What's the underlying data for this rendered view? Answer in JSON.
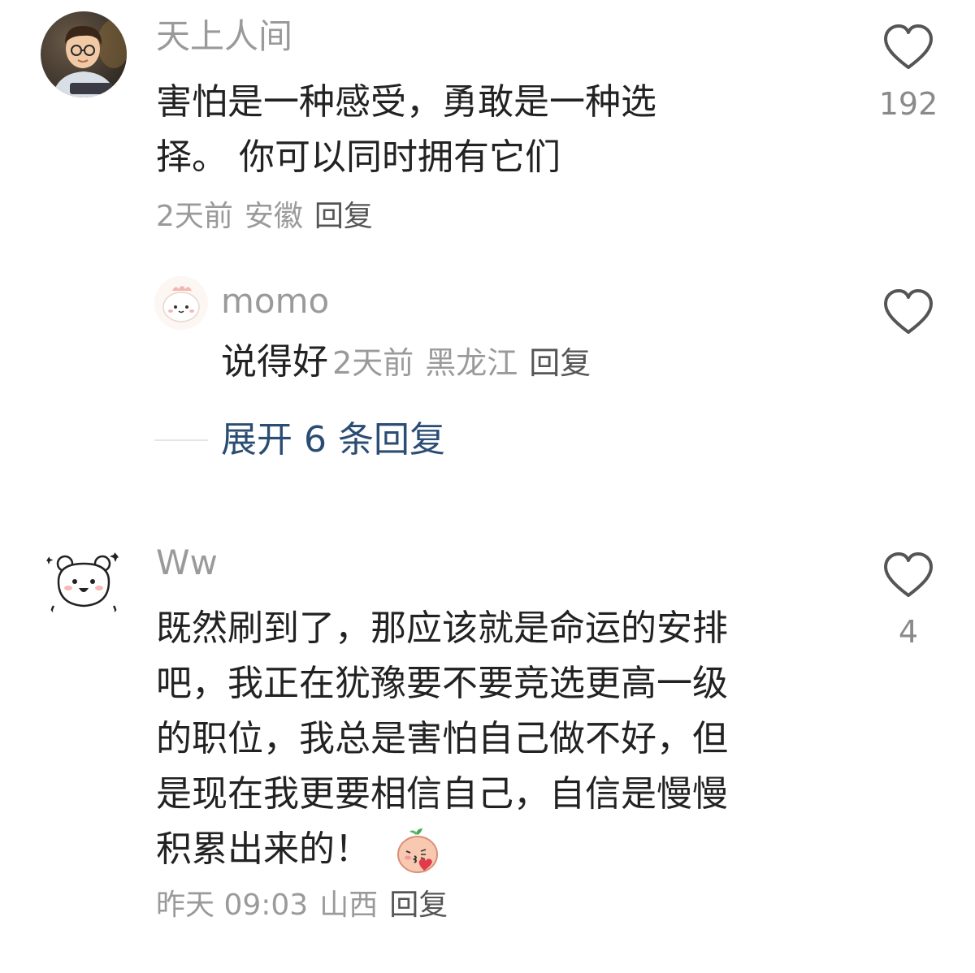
{
  "comments": [
    {
      "username": "天上人间",
      "text_lines": [
        "害怕是一种感受，勇敢是一种选",
        "择。 你可以同时拥有它们"
      ],
      "time": "2天前",
      "region": "安徽",
      "reply_label": "回复",
      "like_count": "192",
      "replies": [
        {
          "username": "momo",
          "text": "说得好",
          "time": "2天前",
          "region": "黑龙江",
          "reply_label": "回复"
        }
      ],
      "expand_label": "展开 6 条回复"
    },
    {
      "username": "Ww",
      "text_lines": [
        "既然刷到了，那应该就是命运的安排",
        "吧，我正在犹豫要不要竞选更高一级",
        "的职位，我总是害怕自己做不好，但",
        "是现在我更要相信自己，自信是慢慢",
        "积累出来的！"
      ],
      "time": "昨天 09:03",
      "region": "山西",
      "reply_label": "回复",
      "like_count": "4"
    }
  ],
  "icons": {
    "like": "heart-outline-icon",
    "emoji": "kiss-heart-sticker-icon"
  },
  "colors": {
    "username": "#9a9a9a",
    "body": "#222222",
    "expand_link": "#2b4d73",
    "icon_stroke": "#555555"
  }
}
